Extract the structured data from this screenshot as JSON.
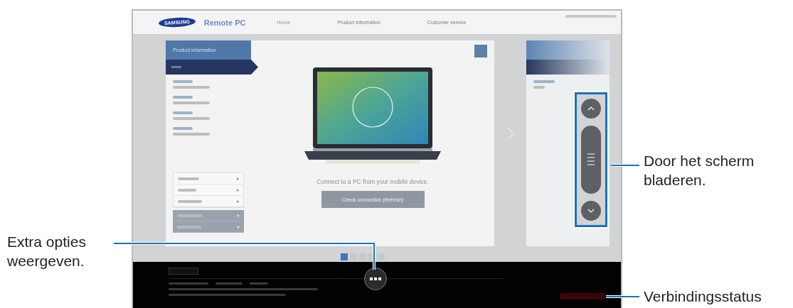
{
  "header": {
    "brand": "SAMSUNG",
    "app_name": "Remote PC",
    "nav": [
      {
        "label": "Home",
        "selected": true
      },
      {
        "label": "Product information",
        "selected": false
      },
      {
        "label": "Customer service",
        "selected": false
      }
    ]
  },
  "main": {
    "panel_title": "Product information",
    "message": "Connect to a PC from your mobile device.",
    "button": "Check connection (Refresh)"
  },
  "pagination": [
    {
      "selected": true
    },
    {
      "selected": false
    },
    {
      "selected": false
    },
    {
      "selected": false
    },
    {
      "selected": false
    }
  ],
  "callouts": [
    {
      "kind": "scroll",
      "text": "Door het scherm bladeren."
    },
    {
      "kind": "options",
      "text": "Extra opties weergeven."
    },
    {
      "kind": "status",
      "text": "Verbindingsstatus"
    }
  ]
}
